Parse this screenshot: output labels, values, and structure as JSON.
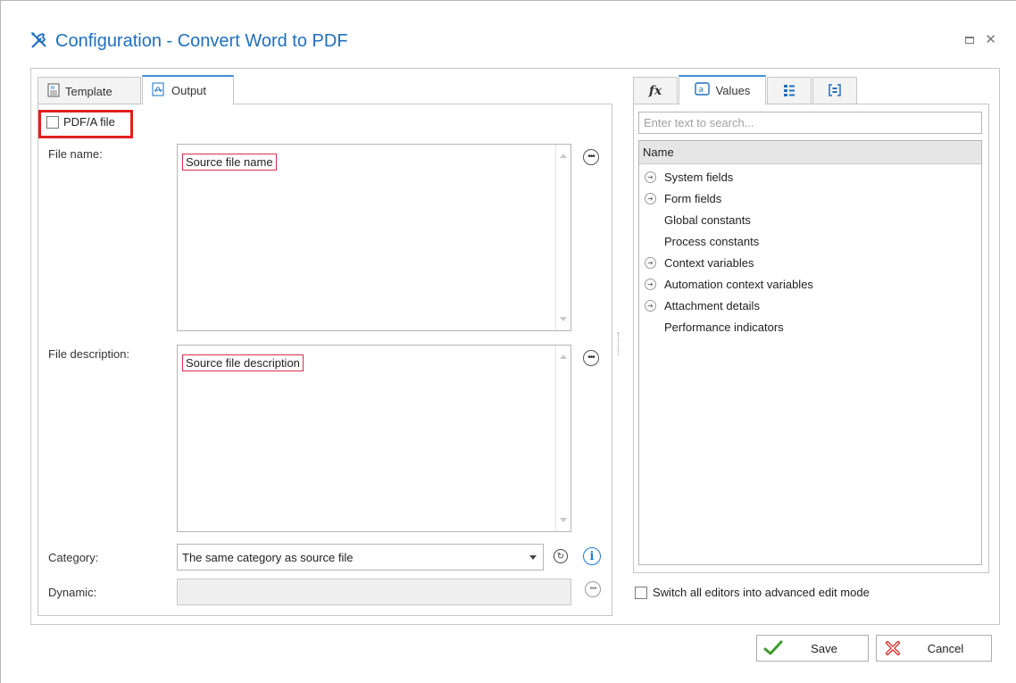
{
  "window": {
    "title": "Configuration - Convert Word to PDF",
    "icon": "tools-icon"
  },
  "tabs": [
    {
      "label": "Template",
      "icon": "word-template-icon",
      "active": false
    },
    {
      "label": "Output",
      "icon": "pdf-output-icon",
      "active": true
    }
  ],
  "output": {
    "pdfa_label": "PDF/A file",
    "pdfa_checked": false,
    "file_name_label": "File name:",
    "file_name_value": "Source file name",
    "file_description_label": "File description:",
    "file_description_value": "Source file description",
    "category_label": "Category:",
    "category_value": "The same category as source file",
    "dynamic_label": "Dynamic:"
  },
  "right_tabs": [
    {
      "label": "",
      "icon": "fx-icon",
      "active": false
    },
    {
      "label": "Values",
      "icon": "values-icon",
      "active": true
    },
    {
      "label": "",
      "icon": "list-icon",
      "active": false
    },
    {
      "label": "",
      "icon": "brackets-icon",
      "active": false
    }
  ],
  "values": {
    "search_placeholder": "Enter text to search...",
    "column_name": "Name",
    "items": [
      {
        "label": "System fields",
        "expandable": true
      },
      {
        "label": "Form fields",
        "expandable": true
      },
      {
        "label": "Global constants",
        "expandable": false
      },
      {
        "label": "Process constants",
        "expandable": false
      },
      {
        "label": "Context variables",
        "expandable": true
      },
      {
        "label": "Automation context variables",
        "expandable": true
      },
      {
        "label": "Attachment details",
        "expandable": true
      },
      {
        "label": "Performance indicators",
        "expandable": false
      }
    ]
  },
  "advanced_mode_label": "Switch all editors into advanced edit mode",
  "buttons": {
    "save": "Save",
    "cancel": "Cancel"
  },
  "colors": {
    "title": "#1f6fbf",
    "highlight_red": "#e02020",
    "chip_border": "#d92e4a",
    "tab_accent": "#3d8fd6",
    "save_green": "#3e9b2f",
    "cancel_red": "#d62828"
  }
}
